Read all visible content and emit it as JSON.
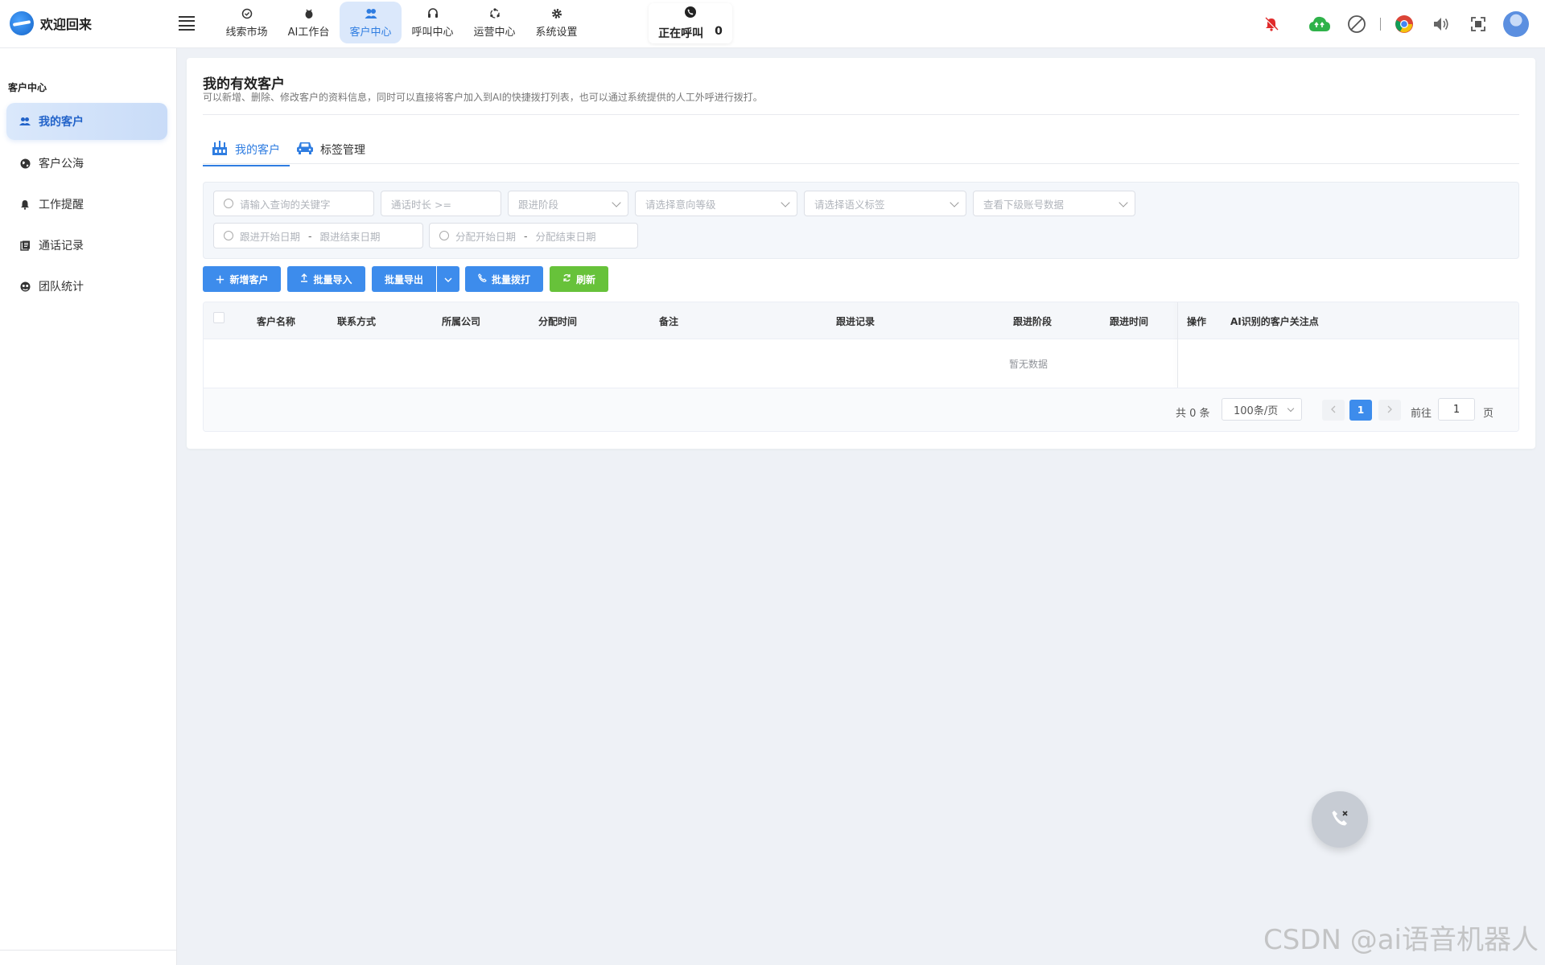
{
  "brand": {
    "title": "欢迎回来"
  },
  "nav": [
    {
      "label": "线索市场",
      "icon": "target-icon"
    },
    {
      "label": "AI工作台",
      "icon": "bug-icon"
    },
    {
      "label": "客户中心",
      "icon": "users-icon",
      "active": true
    },
    {
      "label": "呼叫中心",
      "icon": "headset-icon"
    },
    {
      "label": "运营中心",
      "icon": "cycle-icon"
    },
    {
      "label": "系统设置",
      "icon": "gear-icon"
    }
  ],
  "calling": {
    "label": "正在呼叫",
    "count": "0"
  },
  "sidebar": {
    "title": "客户中心",
    "items": [
      {
        "label": "我的客户",
        "icon": "users-icon",
        "active": true
      },
      {
        "label": "客户公海",
        "icon": "globe-icon"
      },
      {
        "label": "工作提醒",
        "icon": "bell-icon"
      },
      {
        "label": "通话记录",
        "icon": "records-icon"
      },
      {
        "label": "团队统计",
        "icon": "team-icon"
      }
    ]
  },
  "page": {
    "title": "我的有效客户",
    "description": "可以新增、删除、修改客户的资料信息，同时可以直接将客户加入到AI的快捷拨打列表，也可以通过系统提供的人工外呼进行拨打。"
  },
  "tabs": [
    {
      "label": "我的客户",
      "active": true
    },
    {
      "label": "标签管理"
    }
  ],
  "filters": {
    "keyword_placeholder": "请输入查询的关键字",
    "duration_placeholder": "通话时长 >=",
    "stage_placeholder": "跟进阶段",
    "intent_placeholder": "请选择意向等级",
    "semantic_placeholder": "请选择语义标签",
    "subaccount_placeholder": "查看下级账号数据",
    "follow_start": "跟进开始日期",
    "follow_end": "跟进结束日期",
    "assign_start": "分配开始日期",
    "assign_end": "分配结束日期",
    "range_sep": "-"
  },
  "toolbar": {
    "add": "新增客户",
    "import": "批量导入",
    "export": "批量导出",
    "dial": "批量拨打",
    "refresh": "刷新"
  },
  "table": {
    "columns": [
      "客户名称",
      "联系方式",
      "所属公司",
      "分配时间",
      "备注",
      "跟进记录",
      "跟进阶段",
      "跟进时间",
      "AI识别的客户关注点",
      "操作"
    ],
    "empty_text": "暂无数据"
  },
  "pagination": {
    "total": "共 0 条",
    "page_size": "100条/页",
    "current_page": "1",
    "goto_label": "前往",
    "goto_value": "1",
    "page_label": "页"
  },
  "watermark": "CSDN @ai语音机器人",
  "colors": {
    "accent": "#3d8cec",
    "success": "#67c23a",
    "nav_active_bg": "#dbe8fb"
  }
}
